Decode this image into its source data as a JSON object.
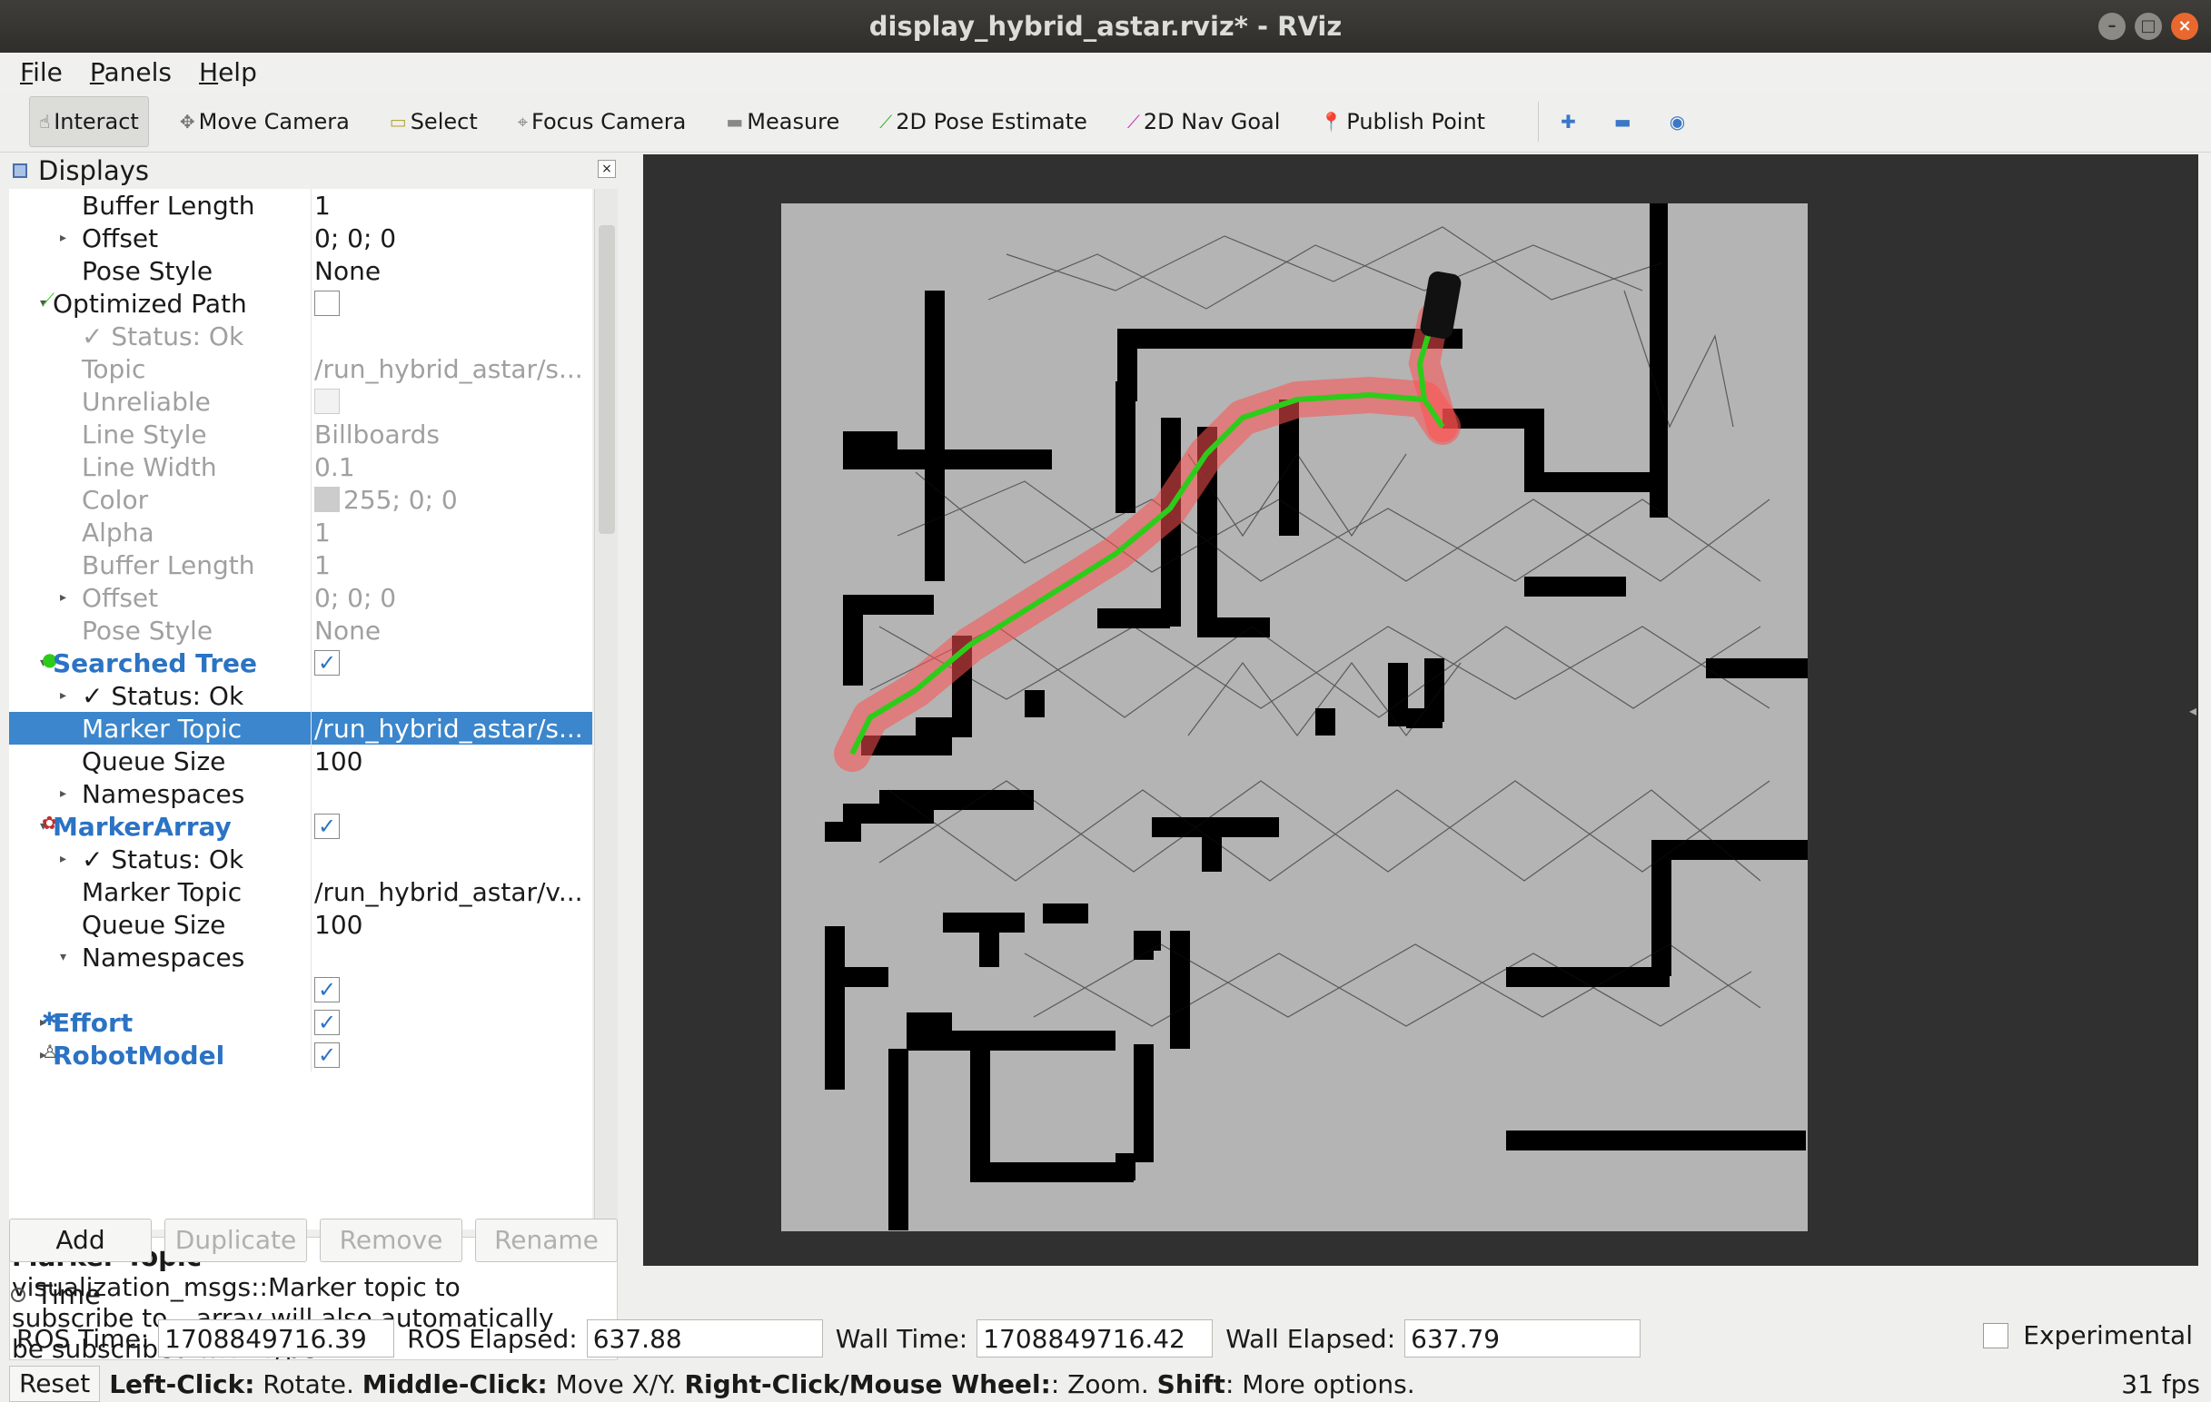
{
  "window": {
    "title": "display_hybrid_astar.rviz* - RViz"
  },
  "menu": [
    "File",
    "Panels",
    "Help"
  ],
  "toolbar": {
    "tools": [
      "Interact",
      "Move Camera",
      "Select",
      "Focus Camera",
      "Measure",
      "2D Pose Estimate",
      "2D Nav Goal",
      "Publish Point"
    ]
  },
  "displays": {
    "title": "Displays",
    "rows": [
      {
        "k": "Buffer Length",
        "v": "1"
      },
      {
        "k": "Offset",
        "v": "0; 0; 0"
      },
      {
        "k": "Pose Style",
        "v": "None"
      },
      {
        "k": "Optimized Path",
        "v": ""
      },
      {
        "k": "Status: Ok",
        "v": ""
      },
      {
        "k": "Topic",
        "v": "/run_hybrid_astar/s..."
      },
      {
        "k": "Unreliable",
        "v": ""
      },
      {
        "k": "Line Style",
        "v": "Billboards"
      },
      {
        "k": "Line Width",
        "v": "0.1"
      },
      {
        "k": "Color",
        "v": "255; 0; 0"
      },
      {
        "k": "Alpha",
        "v": "1"
      },
      {
        "k": "Buffer Length",
        "v": "1"
      },
      {
        "k": "Offset",
        "v": "0; 0; 0"
      },
      {
        "k": "Pose Style",
        "v": "None"
      },
      {
        "k": "Searched Tree",
        "v": ""
      },
      {
        "k": "Status: Ok",
        "v": ""
      },
      {
        "k": "Marker Topic",
        "v": "/run_hybrid_astar/s..."
      },
      {
        "k": "Queue Size",
        "v": "100"
      },
      {
        "k": "Namespaces",
        "v": ""
      },
      {
        "k": "MarkerArray",
        "v": ""
      },
      {
        "k": "Status: Ok",
        "v": ""
      },
      {
        "k": "Marker Topic",
        "v": "/run_hybrid_astar/v..."
      },
      {
        "k": "Queue Size",
        "v": "100"
      },
      {
        "k": "Namespaces",
        "v": ""
      },
      {
        "k": "",
        "v": ""
      },
      {
        "k": "Effort",
        "v": ""
      },
      {
        "k": "RobotModel",
        "v": ""
      }
    ],
    "checkmark": "✓"
  },
  "description": {
    "title": "Marker Topic",
    "body": "visualization_msgs::Marker topic to subscribe to. _array will also automatically be subscribed with type visualization_msgs::MarkerArray."
  },
  "panel_buttons": [
    "Add",
    "Duplicate",
    "Remove",
    "Rename"
  ],
  "time": {
    "title": "Time",
    "ros_time_label": "ROS Time:",
    "ros_time": "1708849716.39",
    "ros_elapsed_label": "ROS Elapsed:",
    "ros_elapsed": "637.88",
    "wall_time_label": "Wall Time:",
    "wall_time": "1708849716.42",
    "wall_elapsed_label": "Wall Elapsed:",
    "wall_elapsed": "637.79",
    "experimental": "Experimental"
  },
  "status": {
    "reset": "Reset",
    "l1": "Left-Click:",
    "t1": " Rotate. ",
    "l2": "Middle-Click:",
    "t2": " Move X/Y. ",
    "l3": "Right-Click/Mouse Wheel:",
    "t3": ": Zoom. ",
    "l4": "Shift",
    "t4": ": More options.",
    "fps": "31 fps"
  },
  "colors": {
    "path": "#2ecc1a",
    "path_halo": "#ff5050",
    "selection": "#3b86cc",
    "link": "#2b73c4"
  },
  "icons": [
    "interact-icon",
    "move-camera-icon",
    "select-icon",
    "focus-camera-icon",
    "measure-icon",
    "pose-estimate-icon",
    "nav-goal-icon",
    "publish-point-icon",
    "plus-icon",
    "minus-icon",
    "eye-icon"
  ]
}
